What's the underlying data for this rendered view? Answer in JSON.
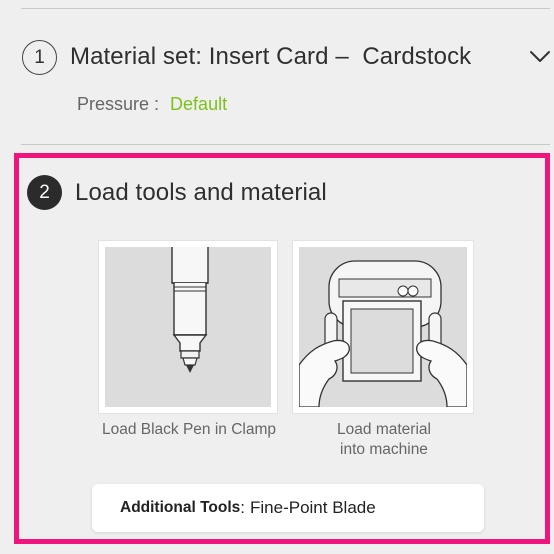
{
  "step1": {
    "number": "1",
    "title": "Material set: Insert Card –  Cardstock",
    "pressure_label": "Pressure :",
    "pressure_value": "Default",
    "expand_icon": "chevron-down-icon"
  },
  "step2": {
    "number": "2",
    "title": "Load tools and material",
    "cards": [
      {
        "caption": "Load Black Pen in Clamp",
        "image": "pen-illustration"
      },
      {
        "caption_line1": "Load material",
        "caption_line2": "into machine",
        "image": "machine-illustration"
      }
    ],
    "additional_tools_label": "Additional Tools",
    "additional_tools_sep": ":",
    "additional_tools_value": "Fine-Point Blade"
  },
  "colors": {
    "highlight_border": "#f0147d",
    "pressure_value": "#7dc11a",
    "background": "#efefef"
  }
}
